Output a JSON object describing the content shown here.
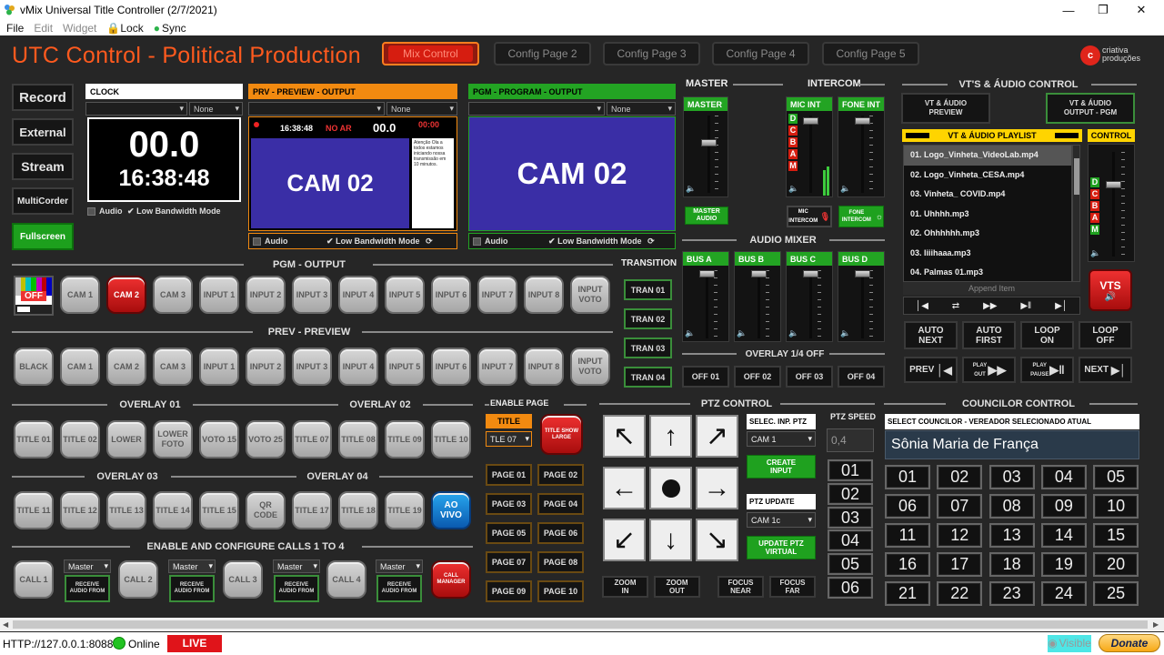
{
  "window": {
    "title": "vMix Universal Title Controller (2/7/2021)"
  },
  "menu": [
    "File",
    "Edit",
    "Widget",
    "Lock",
    "Sync"
  ],
  "header": {
    "title": "UTC Control - Political Production",
    "logo_text": "criativa\nproduções",
    "logo_letter": "c"
  },
  "pages": [
    "Mix Control",
    "Config Page 2",
    "Config Page 3",
    "Config Page 4",
    "Config Page 5"
  ],
  "left_buttons": [
    "Record",
    "External",
    "Stream",
    "MultiCorder",
    "Fullscreen"
  ],
  "clock": {
    "title": "CLOCK",
    "select_right": "None",
    "big": "00.0",
    "time": "16:38:48",
    "audio": "Audio",
    "lowbw": "Low Bandwidth Mode"
  },
  "prv": {
    "title": "PRV - PREVIEW - OUTPUT",
    "select_right": "None",
    "mon_time": "16:38:48",
    "mon_noar": "NO AR",
    "mon_val": "00.0",
    "mon_red": "00:00",
    "cam": "CAM 02",
    "audio": "Audio",
    "lowbw": "Low Bandwidth Mode",
    "side_text": "Atenção Ola a todos estamos iniciando nossa transmissão em 10 minutos."
  },
  "pgm": {
    "title": "PGM - PROGRAM - OUTPUT",
    "select_right": "None",
    "cam": "CAM 02",
    "audio": "Audio",
    "lowbw": "Low Bandwidth Mode"
  },
  "master": {
    "title": "MASTER",
    "fader": "MASTER",
    "button": "MASTER AUDIO"
  },
  "intercom": {
    "title": "INTERCOM",
    "mic": "MIC INT",
    "fone": "FONE INT",
    "mic_btn": "MIC INTERCOM",
    "fone_btn": "FONE INTERCOM",
    "letters": [
      "D",
      "C",
      "B",
      "A",
      "M"
    ]
  },
  "audio_mixer": {
    "title": "AUDIO MIXER",
    "buses": [
      "BUS A",
      "BUS B",
      "BUS C",
      "BUS D"
    ]
  },
  "overlay14": {
    "title": "OVERLAY 1/4 OFF",
    "buttons": [
      "OFF 01",
      "OFF 02",
      "OFF 03",
      "OFF 04"
    ]
  },
  "vt": {
    "title": "VT'S & ÁUDIO CONTROL",
    "preview": "VT & ÁUDIO PREVIEW",
    "output": "VT & ÁUDIO OUTPUT - PGM",
    "playlist_title": "VT & ÁUDIO PLAYLIST",
    "control": "CONTROL",
    "playlist": [
      "01. Logo_Vinheta_VideoLab.mp4",
      "02. Logo_Vinheta_CESA.mp4",
      "03. Vinheta_ COVID.mp4",
      "01. Uhhhh.mp3",
      "02. Ohhhhhh.mp3",
      "03. Iiiihaaa.mp3",
      "04. Palmas 01.mp3"
    ],
    "append": "Append Item",
    "vts": "VTS",
    "auto": [
      "AUTO NEXT",
      "AUTO FIRST",
      "LOOP ON",
      "LOOP OFF"
    ],
    "nav": [
      "PREV",
      "PLAY OUT",
      "PLAY PAUSE",
      "NEXT"
    ]
  },
  "pgm_output": {
    "title": "PGM - OUTPUT",
    "buttons": [
      "OFF",
      "CAM 1",
      "CAM 2",
      "CAM 3",
      "INPUT 1",
      "INPUT 2",
      "INPUT 3",
      "INPUT 4",
      "INPUT 5",
      "INPUT 6",
      "INPUT 7",
      "INPUT 8",
      "INPUT VOTO"
    ]
  },
  "transition": {
    "title": "TRANSITION",
    "buttons": [
      "TRAN 01",
      "TRAN 02",
      "TRAN 03",
      "TRAN 04"
    ]
  },
  "prev_preview": {
    "title": "PREV - PREVIEW",
    "buttons": [
      "BLACK",
      "CAM 1",
      "CAM 2",
      "CAM 3",
      "INPUT 1",
      "INPUT 2",
      "INPUT 3",
      "INPUT 4",
      "INPUT 5",
      "INPUT 6",
      "INPUT 7",
      "INPUT 8",
      "INPUT VOTO"
    ]
  },
  "overlay01": {
    "title": "OVERLAY 01",
    "buttons": [
      "TITLE 01",
      "TITLE 02",
      "LOWER",
      "LOWER FOTO",
      "VOTO 15"
    ]
  },
  "overlay02": {
    "title": "OVERLAY 02",
    "buttons": [
      "VOTO 25",
      "TITLE 07",
      "TITLE 08",
      "TITLE 09",
      "TITLE 10"
    ]
  },
  "overlay03": {
    "title": "OVERLAY 03",
    "buttons": [
      "TITLE 11",
      "TITLE 12",
      "TITLE 13",
      "TITLE 14",
      "TITLE 15"
    ]
  },
  "overlay04": {
    "title": "OVERLAY 04",
    "buttons": [
      "QR CODE",
      "TITLE 17",
      "TITLE 18",
      "TITLE 19",
      "AO VIVO"
    ]
  },
  "calls": {
    "title": "ENABLE AND CONFIGURE CALLS 1 TO 4",
    "calls": [
      "CALL 1",
      "CALL 2",
      "CALL 3",
      "CALL 4"
    ],
    "select": "Master",
    "receive": "RECEIVE AUDIO FROM",
    "manager": "CALL MANAGER"
  },
  "enable_page": {
    "title": "ENABLE PAGE",
    "title_label": "TITLE",
    "title_select": "TLE 07",
    "show_large": "TITLE SHOW LARGE",
    "pages": [
      "PAGE 01",
      "PAGE 02",
      "PAGE 03",
      "PAGE 04",
      "PAGE 05",
      "PAGE 06",
      "PAGE 07",
      "PAGE 08",
      "PAGE 09",
      "PAGE 10"
    ]
  },
  "ptz": {
    "title": "PTZ CONTROL",
    "sel_label": "SELEC. INP. PTZ",
    "sel_value": "CAM 1",
    "create": "CREATE INPUT",
    "update_label": "PTZ UPDATE",
    "update_value": "CAM 1c",
    "update_btn": "UPDATE PTZ VIRTUAL",
    "speed_label": "PTZ SPEED",
    "speed_value": "0,4",
    "speeds": [
      "01",
      "02",
      "03",
      "04",
      "05",
      "06"
    ],
    "zoom": [
      "ZOOM IN",
      "ZOOM OUT"
    ],
    "focus": [
      "FOCUS NEAR",
      "FOCUS FAR"
    ]
  },
  "councilor": {
    "title": "COUNCILOR CONTROL",
    "select_label": "SELECT COUNCILOR - VEREADOR SELECIONADO ATUAL",
    "name": "Sônia Maria de França",
    "numbers": [
      "01",
      "02",
      "03",
      "04",
      "05",
      "06",
      "07",
      "08",
      "09",
      "10",
      "11",
      "12",
      "13",
      "14",
      "15",
      "16",
      "17",
      "18",
      "19",
      "20",
      "21",
      "22",
      "23",
      "24",
      "25"
    ]
  },
  "status": {
    "url": "HTTP://127.0.0.1:8088",
    "online": "Online",
    "live": "LIVE",
    "visible": "Visible",
    "donate": "Donate"
  },
  "colors": {
    "accent": "#ff5a1e",
    "green": "#1fa11f",
    "orange": "#f28a10",
    "red": "#d61d10",
    "monitor": "#3a2ea6"
  }
}
